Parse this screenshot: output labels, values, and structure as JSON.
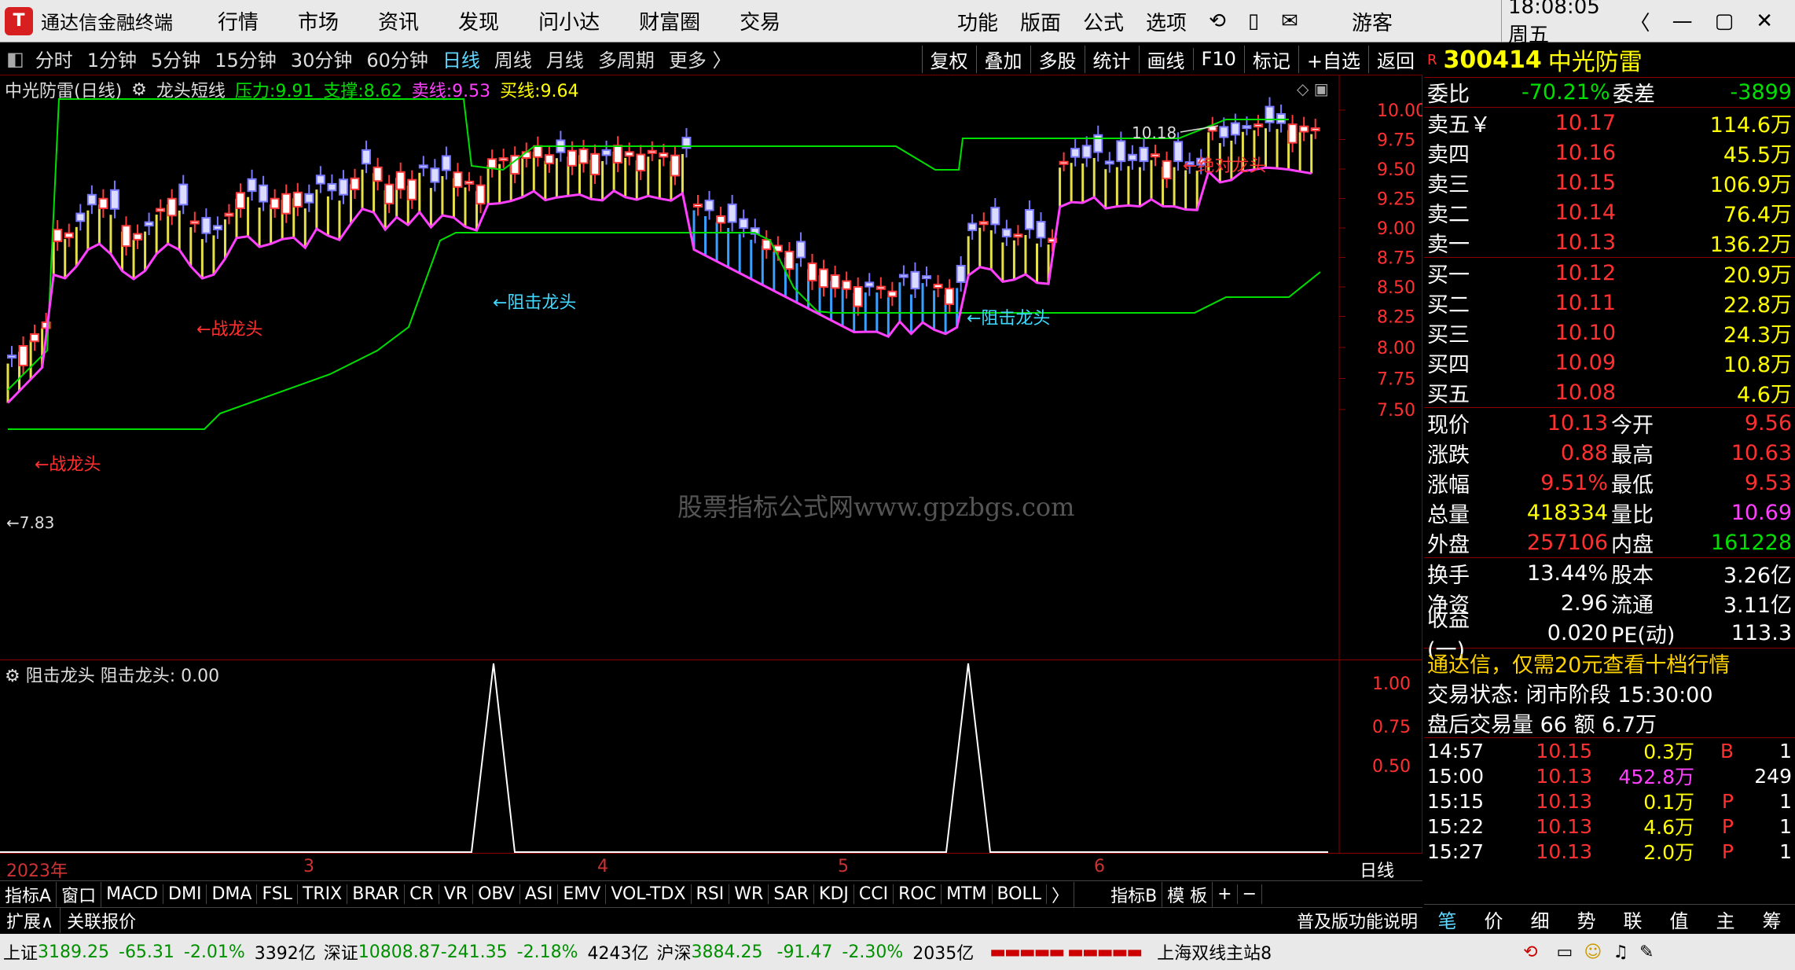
{
  "app": {
    "title": "通达信金融终端",
    "logo": "logo"
  },
  "menu": [
    "行情",
    "市场",
    "资讯",
    "发现",
    "问小达",
    "财富圈",
    "交易"
  ],
  "toolbar_right": [
    "功能",
    "版面",
    "公式",
    "选项"
  ],
  "user": "游客",
  "clock": "18:08:05 周五",
  "period_tabs": [
    "分时",
    "1分钟",
    "5分钟",
    "15分钟",
    "30分钟",
    "60分钟",
    "日线",
    "周线",
    "月线",
    "多周期",
    "更多 〉"
  ],
  "active_period": "日线",
  "period_tools": [
    "复权",
    "叠加",
    "多股",
    "统计",
    "画线",
    "F10",
    "标记",
    "+自选",
    "返回"
  ],
  "indicator_bar": {
    "name": "中光防雷(日线)",
    "formula": "龙头短线",
    "yali_label": "压力:",
    "yali": "9.91",
    "zhicheng_label": "支撑:",
    "zhicheng": "8.62",
    "maixian_label": "卖线:",
    "maixian": "9.53",
    "mairu_label": "买线:",
    "mairu": "9.64"
  },
  "chart_labels": {
    "high_marker": "10.18",
    "low_marker": "7.83",
    "a1": "←绝对龙头",
    "a2": "←阻击龙头",
    "a3": "←阻击龙头",
    "a4": "←战龙头",
    "a5": "←战龙头",
    "watermark": "股票指标公式网www.gpzbgs.com"
  },
  "yaxis": [
    "10.00",
    "9.75",
    "9.50",
    "9.25",
    "9.00",
    "8.75",
    "8.50",
    "8.25",
    "8.00",
    "7.75",
    "7.50"
  ],
  "sub_title": {
    "name": "阻击龙头",
    "label": "阻击龙头:",
    "value": "0.00"
  },
  "sub_yaxis": [
    "1.00",
    "0.75",
    "0.50"
  ],
  "xaxis": {
    "year": "2023年",
    "months": [
      "3",
      "4",
      "5",
      "6"
    ],
    "period": "日线"
  },
  "bottom_tabs": [
    "指标A",
    "窗口",
    "MACD",
    "DMI",
    "DMA",
    "FSL",
    "TRIX",
    "BRAR",
    "CR",
    "VR",
    "OBV",
    "ASI",
    "EMV",
    "VOL-TDX",
    "RSI",
    "WR",
    "SAR",
    "KDJ",
    "CCI",
    "ROC",
    "MTM",
    "BOLL",
    "〉",
    "指标B",
    "模 板",
    "+",
    "−"
  ],
  "ext_row": {
    "left1": "扩展∧",
    "left2": "关联报价",
    "right": "普及版功能说明"
  },
  "stock": {
    "code": "300414",
    "name": "中光防雷"
  },
  "weibi": {
    "l1": "委比",
    "v1": "-70.21%",
    "l2": "委差",
    "v2": "-3899"
  },
  "asks": [
    [
      "卖五￥",
      "10.17",
      "114.6万"
    ],
    [
      "卖四",
      "10.16",
      "45.5万"
    ],
    [
      "卖三",
      "10.15",
      "106.9万"
    ],
    [
      "卖二",
      "10.14",
      "76.4万"
    ],
    [
      "卖一",
      "10.13",
      "136.2万"
    ]
  ],
  "bids": [
    [
      "买一",
      "10.12",
      "20.9万"
    ],
    [
      "买二",
      "10.11",
      "22.8万"
    ],
    [
      "买三",
      "10.10",
      "24.3万"
    ],
    [
      "买四",
      "10.09",
      "10.8万"
    ],
    [
      "买五",
      "10.08",
      "4.6万"
    ]
  ],
  "quote": [
    [
      "现价",
      "10.13",
      "今开",
      "9.56"
    ],
    [
      "涨跌",
      "0.88",
      "最高",
      "10.63"
    ],
    [
      "涨幅",
      "9.51%",
      "最低",
      "9.53"
    ],
    [
      "总量",
      "418334",
      "量比",
      "10.69"
    ],
    [
      "外盘",
      "257106",
      "内盘",
      "161228"
    ]
  ],
  "fund": [
    [
      "换手",
      "13.44%",
      "股本",
      "3.26亿"
    ],
    [
      "净资",
      "2.96",
      "流通",
      "3.11亿"
    ],
    [
      "收益(一)",
      "0.020",
      "PE(动)",
      "113.3"
    ]
  ],
  "promo": "通达信，仅需20元查看十档行情",
  "trade_state": "交易状态: 闭市阶段 15:30:00",
  "after_trade": "盘后交易量 66 额 6.7万",
  "ticks": [
    [
      "14:57",
      "10.15",
      "0.3万",
      "B",
      "1"
    ],
    [
      "15:00",
      "10.13",
      "452.8万",
      "",
      "249"
    ],
    [
      "15:15",
      "10.13",
      "0.1万",
      "P",
      "1"
    ],
    [
      "15:22",
      "10.13",
      "4.6万",
      "P",
      "1"
    ],
    [
      "15:27",
      "10.13",
      "2.0万",
      "P",
      "1"
    ]
  ],
  "side_nav": [
    "笔",
    "价",
    "细",
    "势",
    "联",
    "值",
    "主",
    "筹"
  ],
  "status": {
    "sh_label": "上证",
    "sh": "3189.25",
    "sh_chg": "-65.31",
    "sh_pct": "-2.01%",
    "sh_amt": "3392亿",
    "sz_label": "深证",
    "sz": "10808.87",
    "sz_chg": "-241.35",
    "sz_pct": "-2.18%",
    "sz_amt": "4243亿",
    "hs_label": "沪深",
    "hs": "3884.25",
    "hs_chg": "-91.47",
    "hs_pct": "-2.30%",
    "hs_amt": "2035亿",
    "site": "上海双线主站8"
  }
}
